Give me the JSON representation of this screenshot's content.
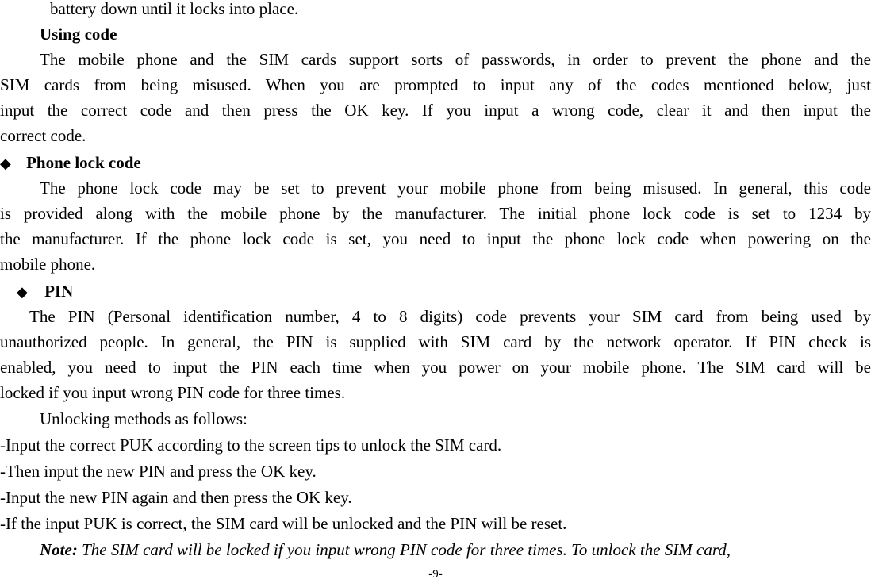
{
  "document": {
    "intro_line": "battery down until it locks into place.",
    "using_code": {
      "heading": "Using code",
      "paragraph_lines": [
        "The mobile phone and the SIM cards support sorts of passwords, in order to prevent the phone and the",
        "SIM cards from being misused. When you are prompted to input any of the codes mentioned below, just",
        "input the correct code and then press the OK key. If you input a wrong code, clear it and then input the",
        "correct code."
      ]
    },
    "phone_lock": {
      "bullet": "◆",
      "heading": "Phone lock code",
      "paragraph_lines": [
        "The phone lock code may be set to prevent your mobile phone from being misused. In general, this code",
        "is provided along with the mobile phone by the manufacturer. The initial phone lock code is set to 1234 by",
        "the manufacturer. If the phone lock code is set, you need to input the phone lock code when powering on the",
        "mobile phone."
      ]
    },
    "pin": {
      "bullet": "◆",
      "heading": "PIN",
      "paragraph_lines": [
        "The PIN (Personal identification number, 4 to 8 digits) code prevents your SIM card from being used by",
        "unauthorized people. In general, the PIN is supplied with SIM card by the network operator. If PIN check is",
        "enabled, you need to input the PIN each time when you power on your mobile phone. The SIM card will be",
        "locked if you input wrong PIN code for three times."
      ],
      "unlocking_intro": "Unlocking methods as follows:",
      "steps": [
        "-Input the correct PUK according to the screen tips to unlock the SIM card.",
        "-Then input the new PIN and press the OK key.",
        "-Input the new PIN again and then press the OK key.",
        "-If the input PUK is correct, the SIM card will be unlocked and the PIN will be reset."
      ],
      "note_label": "Note:",
      "note_text": " The SIM card will be locked if you input wrong PIN code for three times. To unlock the SIM card,"
    },
    "page_number": "-9-"
  }
}
